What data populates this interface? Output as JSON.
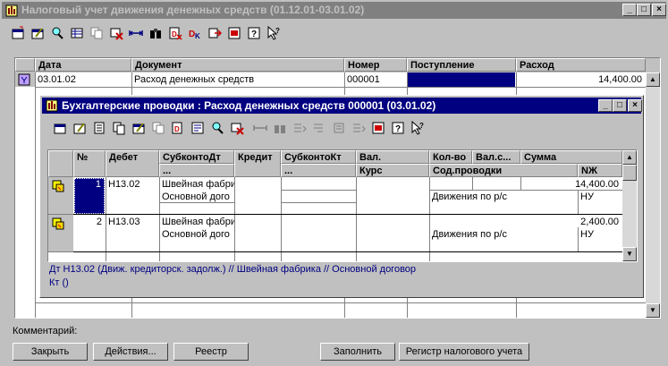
{
  "main_window": {
    "title": "Налоговый учет движения денежных средств (01.12.01-03.01.02)",
    "columns": [
      "Дата",
      "Документ",
      "Номер",
      "Поступление",
      "Расход"
    ],
    "rows": [
      {
        "date": "03.01.02",
        "document": "Расход денежных средств",
        "number": "000001",
        "income": "",
        "expense": "14,400.00"
      }
    ]
  },
  "journal_window": {
    "title": "Бухгалтерские проводки  : Расход денежных средств 000001 (03.01.02)",
    "header_row1": [
      "№",
      "Дебет",
      "СубконтоДт",
      "Кредит",
      "СубконтоКт",
      "Вал.",
      "Кол-во",
      "Вал.с...",
      "Сумма"
    ],
    "header_row2": [
      "...",
      "...",
      "Курс",
      "Сод.проводки",
      "NЖ"
    ],
    "entries": [
      {
        "num": "1",
        "debit": "Н13.02",
        "subconto_dt": [
          "Швейная фабри",
          "Основной дого"
        ],
        "amount": "14,400.00",
        "description": "Движения по р/с",
        "journal": "НУ"
      },
      {
        "num": "2",
        "debit": "Н13.03",
        "subconto_dt": [
          "Швейная фабри",
          "Основной дого"
        ],
        "amount": "2,400.00",
        "description": "Движения по р/с",
        "journal": "НУ"
      }
    ],
    "status_line1": "Дт Н13.02 (Движ. кредиторск. задолж.) // Швейная фабрика // Основной договор",
    "status_line2": "Кт ()"
  },
  "comment_label": "Комментарий:",
  "buttons": {
    "close": "Закрыть",
    "actions": "Действия...",
    "registry": "Реестр",
    "fill": "Заполнить",
    "tax_register": "Регистр налогового учета"
  },
  "colors": {
    "title_active": "#000080",
    "title_inactive": "#808080",
    "selection": "#000080",
    "status_text": "#000080",
    "face": "#c0c0c0"
  },
  "icons": {
    "main_toolbar": [
      "new-doc-icon",
      "edit-doc-icon",
      "find-icon",
      "grid-icon",
      "copy-icon",
      "delete-icon",
      "interval-icon",
      "binoculars-icon",
      "doc-dt-icon",
      "dk-icon",
      "export-icon",
      "journal-icon",
      "help-icon",
      "pointer-help-icon"
    ],
    "journal_toolbar": [
      "new-entry-icon",
      "edit-entry-icon",
      "doc-icon",
      "copy-doc-icon",
      "edit2-icon",
      "copy-icon",
      "doc-dt-icon",
      "report-icon",
      "find-icon",
      "delete-icon",
      "interval-icon",
      "binoculars-icon",
      "move-down-icon",
      "move-up-icon",
      "sort-icon",
      "copy-rows-icon",
      "journal-icon",
      "help-icon",
      "pointer-help-icon"
    ]
  }
}
